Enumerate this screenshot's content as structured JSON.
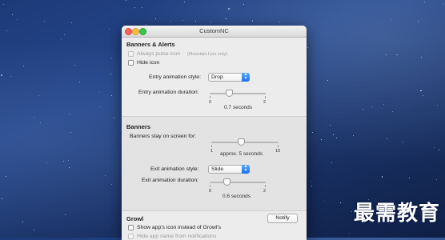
{
  "window": {
    "title": "CustomNC"
  },
  "banners_alerts": {
    "heading": "Banners & Alerts",
    "always_pulse_icon": {
      "label": "Always pulse icon",
      "note": "(Mountain Lion only)",
      "checked": false,
      "enabled": false
    },
    "hide_icon": {
      "label": "Hide icon",
      "checked": false
    },
    "entry_style": {
      "label": "Entry animation style:",
      "value": "Drop"
    },
    "entry_duration": {
      "label": "Entry animation duration:",
      "min": "0",
      "max": "2",
      "value": 0.7,
      "value_label": "0.7 seconds"
    }
  },
  "banners": {
    "heading": "Banners",
    "stay_on_screen": {
      "label": "Banners stay on screen for:",
      "min": "1",
      "max": "10",
      "value": 5,
      "value_label": "approx. 5 seconds"
    },
    "exit_style": {
      "label": "Exit animation style:",
      "value": "Slide"
    },
    "exit_duration": {
      "label": "Exit animation duration:",
      "min": "0",
      "max": "2",
      "value": 0.6,
      "value_label": "0.6 seconds"
    }
  },
  "growl": {
    "heading": "Growl",
    "notify_button": "Notify",
    "show_app_icon": {
      "label": "Show app's icon instead of Growl's",
      "checked": false
    },
    "hide_app_name": {
      "label": "Hide app name from notifications",
      "checked": false,
      "enabled": false
    }
  },
  "watermark": "最需教育",
  "colors": {
    "accent": "#1870f3",
    "window_bg": "#ececec",
    "desktop": "#1d3a78"
  },
  "icons": {
    "popup_arrows": "updown-chevron-icon",
    "close": "close-icon",
    "minimize": "minimize-icon",
    "zoom": "zoom-icon"
  }
}
